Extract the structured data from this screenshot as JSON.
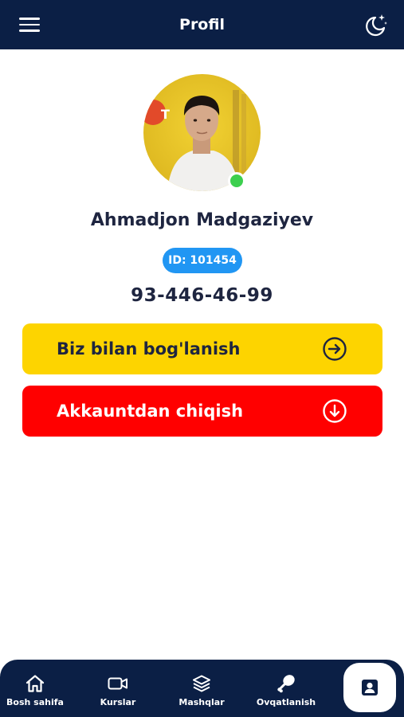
{
  "header": {
    "title": "Profil",
    "menu_icon": "hamburger-menu-icon",
    "theme_icon": "moon-stars-icon",
    "background": "#0b1f45"
  },
  "profile": {
    "name": "Ahmadjon Madgaziyev",
    "id_label": "ID: 101454",
    "phone": "93-446-46-99",
    "online": true
  },
  "actions": {
    "contact_label": "Biz bilan bog'lanish",
    "contact_icon": "arrow-right-circle-icon",
    "contact_color": "#fdd400",
    "logout_label": "Akkauntdan chiqish",
    "logout_icon": "arrow-down-circle-icon",
    "logout_color": "#ff0000"
  },
  "bottom_nav": {
    "items": [
      {
        "label": "Bosh sahifa",
        "icon": "home-icon"
      },
      {
        "label": "Kurslar",
        "icon": "video-icon"
      },
      {
        "label": "Mashqlar",
        "icon": "layers-icon"
      },
      {
        "label": "Ovqatlanish",
        "icon": "drumstick-icon"
      }
    ],
    "active_icon": "profile-card-icon"
  }
}
